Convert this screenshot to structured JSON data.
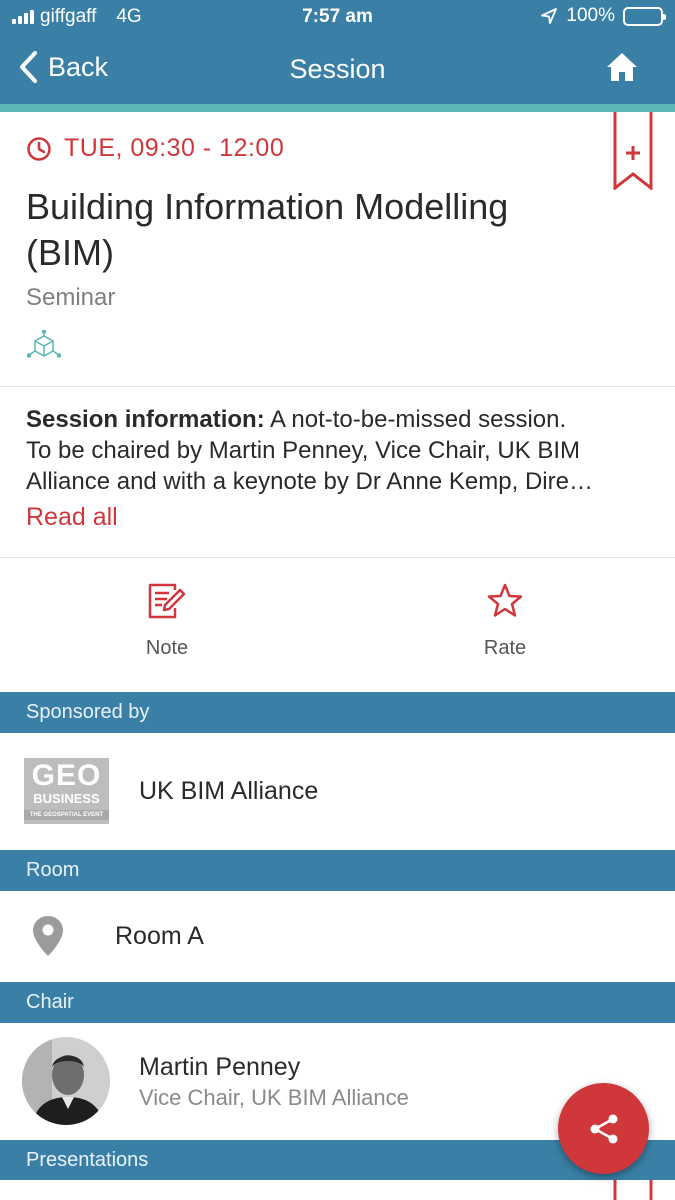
{
  "status_bar": {
    "carrier": "giffgaff",
    "network": "4G",
    "time": "7:57 am",
    "battery": "100%"
  },
  "nav": {
    "back_label": "Back",
    "title": "Session"
  },
  "session": {
    "time": "TUE, 09:30 - 12:00",
    "title_line1": "Building Information Modelling",
    "title_line2": "(BIM)",
    "type": "Seminar",
    "info_heading": "Session information:",
    "info_line1": " A not-to-be-missed session.",
    "info_line2": "To be chaired by Martin Penney, Vice Chair, UK BIM",
    "info_line3": "Alliance and with a keynote by Dr Anne Kemp, Dire…",
    "read_all": "Read all"
  },
  "actions": {
    "note_label": "Note",
    "rate_label": "Rate"
  },
  "sponsored": {
    "header": "Sponsored by",
    "logo_line1": "GEO",
    "logo_line2": "BUSINESS",
    "logo_line3": "THE GEOSPATIAL EVENT",
    "name": "UK BIM Alliance"
  },
  "room": {
    "header": "Room",
    "name": "Room A"
  },
  "chair": {
    "header": "Chair",
    "name": "Martin Penney",
    "role": "Vice Chair, UK BIM Alliance"
  },
  "presentations": {
    "header": "Presentations"
  },
  "colors": {
    "primary": "#3a7fa5",
    "accent": "#d0373b",
    "teal": "#5cb6b3"
  },
  "icons": [
    "signal-icon",
    "location-arrow-icon",
    "battery-icon",
    "back-chevron-icon",
    "home-icon",
    "bookmark-add-icon",
    "clock-icon",
    "cube-icon",
    "note-icon",
    "star-icon",
    "map-pin-icon",
    "share-icon"
  ]
}
